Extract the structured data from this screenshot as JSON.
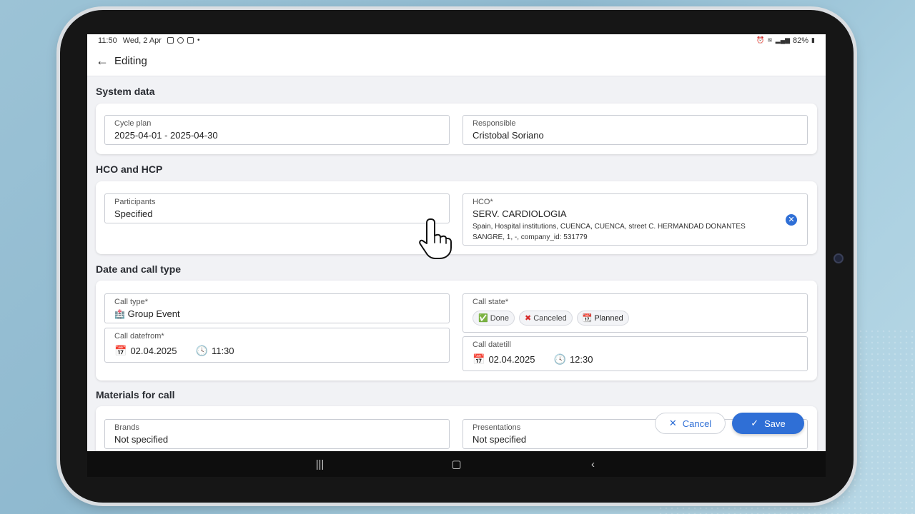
{
  "status_bar": {
    "time": "11:50",
    "date": "Wed, 2 Apr",
    "battery": "82%"
  },
  "appbar": {
    "title": "Editing"
  },
  "sections": {
    "system": {
      "title": "System data",
      "cycle_plan": {
        "label": "Cycle plan",
        "value": "2025-04-01 - 2025-04-30"
      },
      "responsible": {
        "label": "Responsible",
        "value": "Cristobal Soriano"
      }
    },
    "hco_hcp": {
      "title": "HCO and HCP",
      "participants": {
        "label": "Participants",
        "value": "Specified"
      },
      "hco": {
        "label": "HCO*",
        "value": "SERV. CARDIOLOGIA",
        "address": "Spain, Hospital institutions, CUENCA, CUENCA, street C. HERMANDAD DONANTES SANGRE, 1, -, company_id: 531779"
      }
    },
    "date_call": {
      "title": "Date and call type",
      "call_type": {
        "label": "Call type*",
        "value": "Group Event"
      },
      "call_state": {
        "label": "Call state*",
        "options": [
          "Done",
          "Canceled",
          "Planned"
        ]
      },
      "date_from": {
        "label": "Call datefrom*",
        "date": "02.04.2025",
        "time": "11:30"
      },
      "date_till": {
        "label": "Call datetill",
        "date": "02.04.2025",
        "time": "12:30"
      }
    },
    "materials": {
      "title": "Materials for call",
      "brands": {
        "label": "Brands",
        "value": "Not specified"
      },
      "presentations": {
        "label": "Presentations",
        "value": "Not specified"
      }
    }
  },
  "actions": {
    "cancel": "Cancel",
    "save": "Save"
  },
  "colors": {
    "accent": "#2f6fd6",
    "screen_bg": "#f1f2f5"
  }
}
